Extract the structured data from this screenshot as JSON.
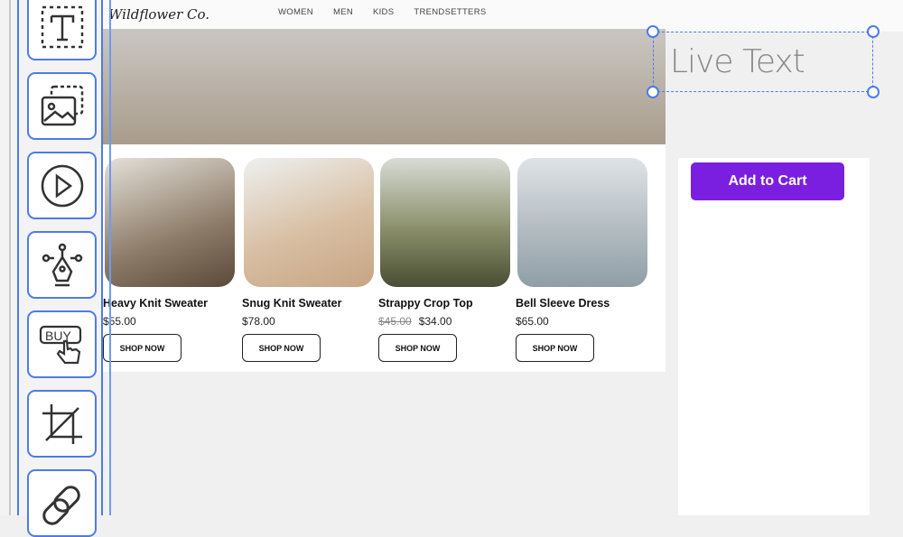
{
  "site": {
    "logo": "Wildflower Co.",
    "nav": [
      "WOMEN",
      "MEN",
      "KIDS",
      "TRENDSETTERS"
    ]
  },
  "tools": [
    {
      "name": "text-tool",
      "icon": "text-icon"
    },
    {
      "name": "image-tool",
      "icon": "image-icon"
    },
    {
      "name": "video-tool",
      "icon": "play-icon"
    },
    {
      "name": "pen-tool",
      "icon": "pen-tool-icon"
    },
    {
      "name": "buy-button-tool",
      "icon": "buy-icon",
      "label": "BUY"
    },
    {
      "name": "crop-tool",
      "icon": "crop-icon"
    },
    {
      "name": "link-tool",
      "icon": "link-icon"
    }
  ],
  "products": [
    {
      "name": "Heavy Knit Sweater",
      "price": "$55.00",
      "cta": "SHOP NOW"
    },
    {
      "name": "Snug Knit Sweater",
      "price": "$78.00",
      "cta": "SHOP NOW"
    },
    {
      "name": "Strappy Crop Top",
      "old_price": "$45.00",
      "price": "$34.00",
      "cta": "SHOP NOW"
    },
    {
      "name": "Bell Sleeve Dress",
      "price": "$65.00",
      "cta": "SHOP NOW"
    }
  ],
  "add_to_cart": "Add to Cart",
  "live_text": "Live Text",
  "colors": {
    "accent": "#7a1fe0",
    "selection": "#4d7be8"
  }
}
